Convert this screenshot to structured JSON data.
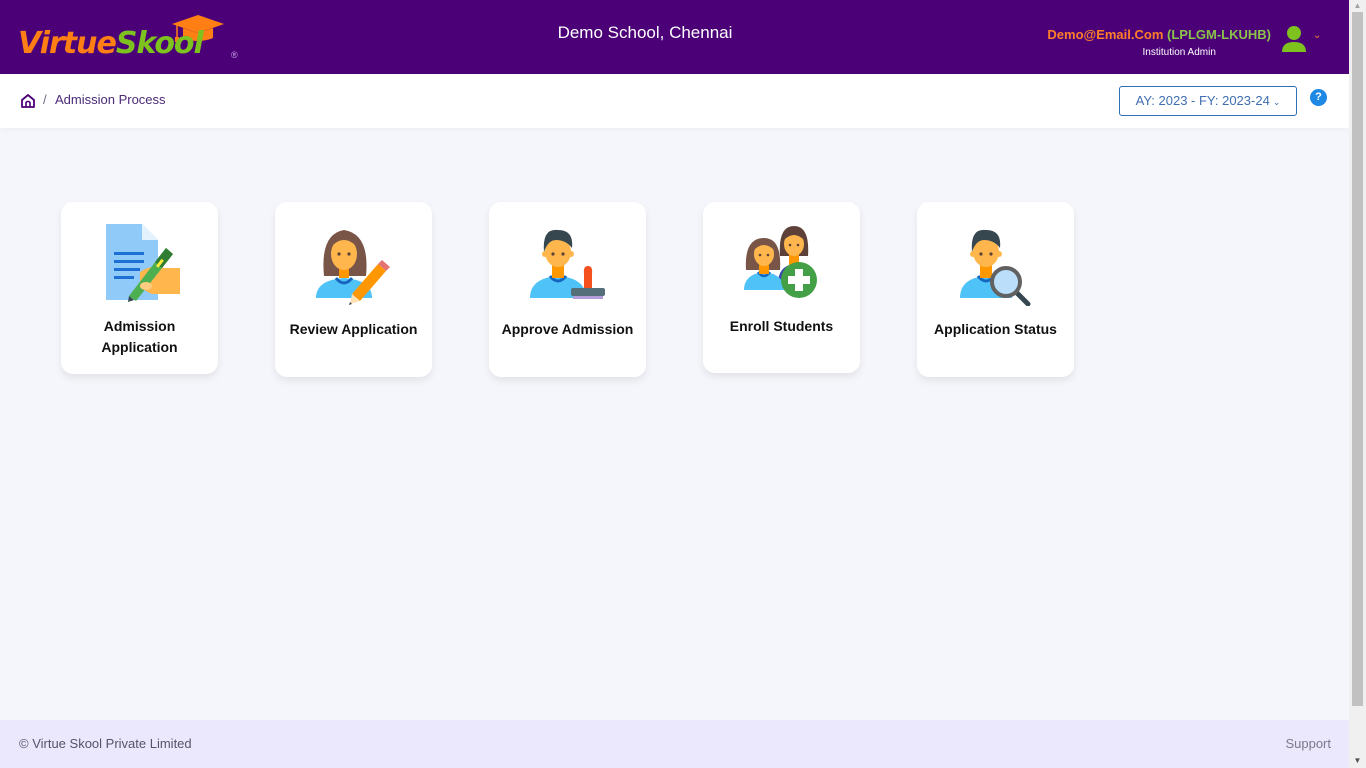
{
  "header": {
    "logo": {
      "part1": "Virtue",
      "part2": "Skool",
      "reg": "®"
    },
    "school_name": "Demo School, Chennai",
    "user": {
      "email": "Demo@Email.Com",
      "code": "(LPLGM-LKUHB)",
      "role": "Institution Admin",
      "chevron": "⌄"
    }
  },
  "breadcrumb": {
    "separator": "/",
    "current": "Admission Process"
  },
  "year_selector": {
    "value": "AY: 2023 - FY: 2023-24",
    "chevron": "⌄"
  },
  "help": {
    "glyph": "?"
  },
  "cards": [
    {
      "label": "Admission Application",
      "icon": "document-pen-icon"
    },
    {
      "label": "Review Application",
      "icon": "person-pencil-icon"
    },
    {
      "label": "Approve Admission",
      "icon": "person-stamp-icon"
    },
    {
      "label": "Enroll Students",
      "icon": "group-add-icon"
    },
    {
      "label": "Application Status",
      "icon": "person-search-icon"
    }
  ],
  "footer": {
    "copyright": "© Virtue Skool Private Limited",
    "support": "Support"
  },
  "colors": {
    "header_bg": "#4b0078",
    "accent_orange": "#ff7f14",
    "accent_green": "#7dc21e",
    "footer_bg": "#ebe7fd",
    "select_border": "#2d6fb8"
  },
  "scrollbar": {
    "up": "▲",
    "down": "▼"
  }
}
